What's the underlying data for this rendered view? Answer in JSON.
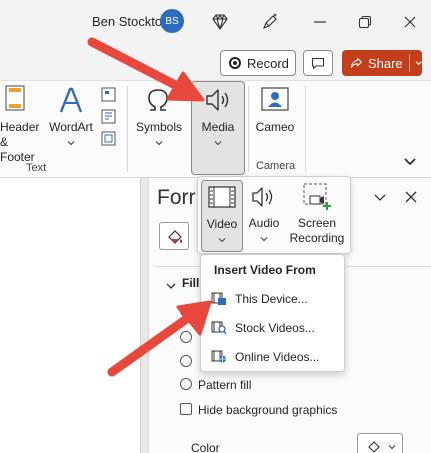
{
  "titlebar": {
    "user_name": "Ben Stockton",
    "avatar_initials": "BS",
    "icons": [
      "diamond-icon",
      "pen-sparkle-icon",
      "minimize-icon",
      "restore-icon",
      "close-icon"
    ]
  },
  "actions": {
    "record_label": "Record",
    "share_label": "Share"
  },
  "ribbon": {
    "header_footer_label_1": "Header",
    "header_footer_label_2": "& Footer",
    "wordart_label": "WordArt",
    "text_group_label": "Text",
    "symbols_label": "Symbols",
    "media_label": "Media",
    "cameo_label": "Cameo",
    "camera_group_label": "Camera"
  },
  "media_panel": {
    "video_label": "Video",
    "audio_label": "Audio",
    "screen_recording_label_1": "Screen",
    "screen_recording_label_2": "Recording"
  },
  "video_menu": {
    "heading": "Insert Video From",
    "items": [
      {
        "label": "This Device..."
      },
      {
        "label": "Stock Videos..."
      },
      {
        "label": "Online Videos..."
      }
    ]
  },
  "format_pane": {
    "title_partial": "Forr",
    "fill_heading": "Fill",
    "pattern_fill_label": "Pattern fill",
    "hide_background_label": "Hide background graphics",
    "color_label": "Color"
  },
  "colors": {
    "share_bg": "#c43e1c",
    "avatar_bg": "#2b6cc0",
    "arrow_red": "#e8473b",
    "accent_blue": "#2b6cc0"
  }
}
